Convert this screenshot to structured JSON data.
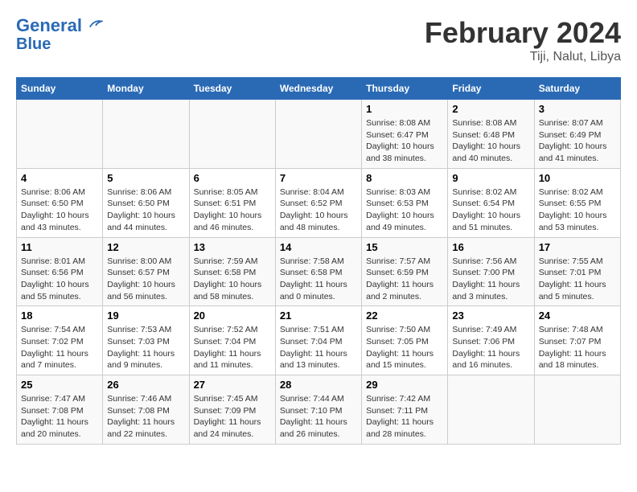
{
  "header": {
    "logo_line1": "General",
    "logo_line2": "Blue",
    "title": "February 2024",
    "subtitle": "Tiji, Nalut, Libya"
  },
  "calendar": {
    "days_of_week": [
      "Sunday",
      "Monday",
      "Tuesday",
      "Wednesday",
      "Thursday",
      "Friday",
      "Saturday"
    ],
    "weeks": [
      [
        {
          "day": "",
          "detail": ""
        },
        {
          "day": "",
          "detail": ""
        },
        {
          "day": "",
          "detail": ""
        },
        {
          "day": "",
          "detail": ""
        },
        {
          "day": "1",
          "detail": "Sunrise: 8:08 AM\nSunset: 6:47 PM\nDaylight: 10 hours and 38 minutes."
        },
        {
          "day": "2",
          "detail": "Sunrise: 8:08 AM\nSunset: 6:48 PM\nDaylight: 10 hours and 40 minutes."
        },
        {
          "day": "3",
          "detail": "Sunrise: 8:07 AM\nSunset: 6:49 PM\nDaylight: 10 hours and 41 minutes."
        }
      ],
      [
        {
          "day": "4",
          "detail": "Sunrise: 8:06 AM\nSunset: 6:50 PM\nDaylight: 10 hours and 43 minutes."
        },
        {
          "day": "5",
          "detail": "Sunrise: 8:06 AM\nSunset: 6:50 PM\nDaylight: 10 hours and 44 minutes."
        },
        {
          "day": "6",
          "detail": "Sunrise: 8:05 AM\nSunset: 6:51 PM\nDaylight: 10 hours and 46 minutes."
        },
        {
          "day": "7",
          "detail": "Sunrise: 8:04 AM\nSunset: 6:52 PM\nDaylight: 10 hours and 48 minutes."
        },
        {
          "day": "8",
          "detail": "Sunrise: 8:03 AM\nSunset: 6:53 PM\nDaylight: 10 hours and 49 minutes."
        },
        {
          "day": "9",
          "detail": "Sunrise: 8:02 AM\nSunset: 6:54 PM\nDaylight: 10 hours and 51 minutes."
        },
        {
          "day": "10",
          "detail": "Sunrise: 8:02 AM\nSunset: 6:55 PM\nDaylight: 10 hours and 53 minutes."
        }
      ],
      [
        {
          "day": "11",
          "detail": "Sunrise: 8:01 AM\nSunset: 6:56 PM\nDaylight: 10 hours and 55 minutes."
        },
        {
          "day": "12",
          "detail": "Sunrise: 8:00 AM\nSunset: 6:57 PM\nDaylight: 10 hours and 56 minutes."
        },
        {
          "day": "13",
          "detail": "Sunrise: 7:59 AM\nSunset: 6:58 PM\nDaylight: 10 hours and 58 minutes."
        },
        {
          "day": "14",
          "detail": "Sunrise: 7:58 AM\nSunset: 6:58 PM\nDaylight: 11 hours and 0 minutes."
        },
        {
          "day": "15",
          "detail": "Sunrise: 7:57 AM\nSunset: 6:59 PM\nDaylight: 11 hours and 2 minutes."
        },
        {
          "day": "16",
          "detail": "Sunrise: 7:56 AM\nSunset: 7:00 PM\nDaylight: 11 hours and 3 minutes."
        },
        {
          "day": "17",
          "detail": "Sunrise: 7:55 AM\nSunset: 7:01 PM\nDaylight: 11 hours and 5 minutes."
        }
      ],
      [
        {
          "day": "18",
          "detail": "Sunrise: 7:54 AM\nSunset: 7:02 PM\nDaylight: 11 hours and 7 minutes."
        },
        {
          "day": "19",
          "detail": "Sunrise: 7:53 AM\nSunset: 7:03 PM\nDaylight: 11 hours and 9 minutes."
        },
        {
          "day": "20",
          "detail": "Sunrise: 7:52 AM\nSunset: 7:04 PM\nDaylight: 11 hours and 11 minutes."
        },
        {
          "day": "21",
          "detail": "Sunrise: 7:51 AM\nSunset: 7:04 PM\nDaylight: 11 hours and 13 minutes."
        },
        {
          "day": "22",
          "detail": "Sunrise: 7:50 AM\nSunset: 7:05 PM\nDaylight: 11 hours and 15 minutes."
        },
        {
          "day": "23",
          "detail": "Sunrise: 7:49 AM\nSunset: 7:06 PM\nDaylight: 11 hours and 16 minutes."
        },
        {
          "day": "24",
          "detail": "Sunrise: 7:48 AM\nSunset: 7:07 PM\nDaylight: 11 hours and 18 minutes."
        }
      ],
      [
        {
          "day": "25",
          "detail": "Sunrise: 7:47 AM\nSunset: 7:08 PM\nDaylight: 11 hours and 20 minutes."
        },
        {
          "day": "26",
          "detail": "Sunrise: 7:46 AM\nSunset: 7:08 PM\nDaylight: 11 hours and 22 minutes."
        },
        {
          "day": "27",
          "detail": "Sunrise: 7:45 AM\nSunset: 7:09 PM\nDaylight: 11 hours and 24 minutes."
        },
        {
          "day": "28",
          "detail": "Sunrise: 7:44 AM\nSunset: 7:10 PM\nDaylight: 11 hours and 26 minutes."
        },
        {
          "day": "29",
          "detail": "Sunrise: 7:42 AM\nSunset: 7:11 PM\nDaylight: 11 hours and 28 minutes."
        },
        {
          "day": "",
          "detail": ""
        },
        {
          "day": "",
          "detail": ""
        }
      ]
    ]
  }
}
